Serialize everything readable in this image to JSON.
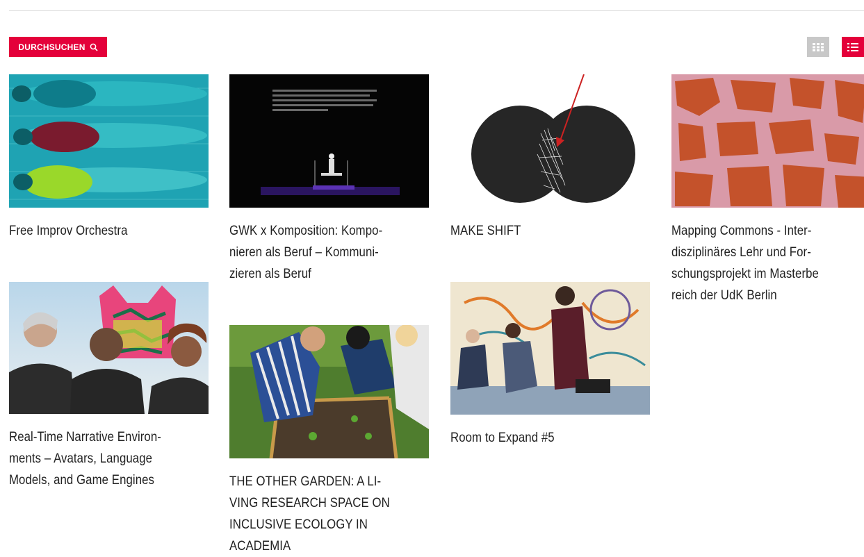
{
  "toolbar": {
    "search_label": "DURCHSUCHEN",
    "search_icon": "search-icon",
    "grid_view_icon": "grid-view-icon",
    "list_view_icon": "list-view-icon"
  },
  "colors": {
    "accent": "#e4003a",
    "inactive_toggle": "#c8c8c8",
    "text": "#222222"
  },
  "projects": [
    {
      "title": "Free Improv Orchestra"
    },
    {
      "title": "GWK x Komposition: Kompo-\nnieren als Beruf – Kommuni-\nzieren als Beruf"
    },
    {
      "title": "MAKE SHIFT"
    },
    {
      "title": "Mapping Commons - Inter-\ndisziplinäres Lehr und For-\nschungsprojekt im Masterbe\nreich der UdK Berlin"
    },
    {
      "title": "Real-Time Narrative Environ-\nments – Avatars, Language\nModels, and Game Engines"
    },
    {
      "title": "THE OTHER GARDEN: A LI-\nVING RESEARCH SPACE ON\nINCLUSIVE ECOLOGY IN\nACADEMIA"
    },
    {
      "title": "Room to Expand #5"
    }
  ]
}
